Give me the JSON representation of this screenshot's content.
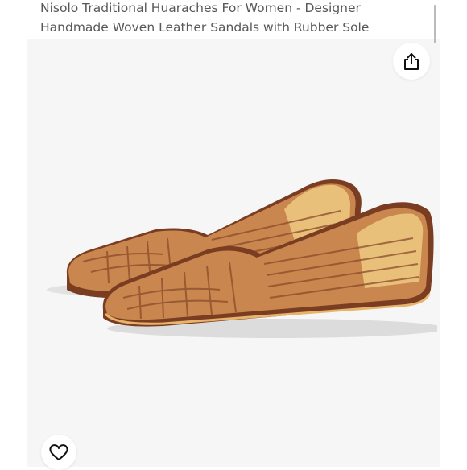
{
  "product": {
    "title_line1": "Nisolo Traditional Huaraches For Women - Designer",
    "title_line2": "Handmade Woven Leather Sandals with Rubber Sole"
  },
  "icons": {
    "share": "share-icon",
    "favorite": "heart-icon"
  },
  "colors": {
    "title_text": "#575959",
    "image_background": "#f6f6f6",
    "leather": "#c9864e",
    "sole": "#7a3d22",
    "insole": "#e9c07a"
  }
}
